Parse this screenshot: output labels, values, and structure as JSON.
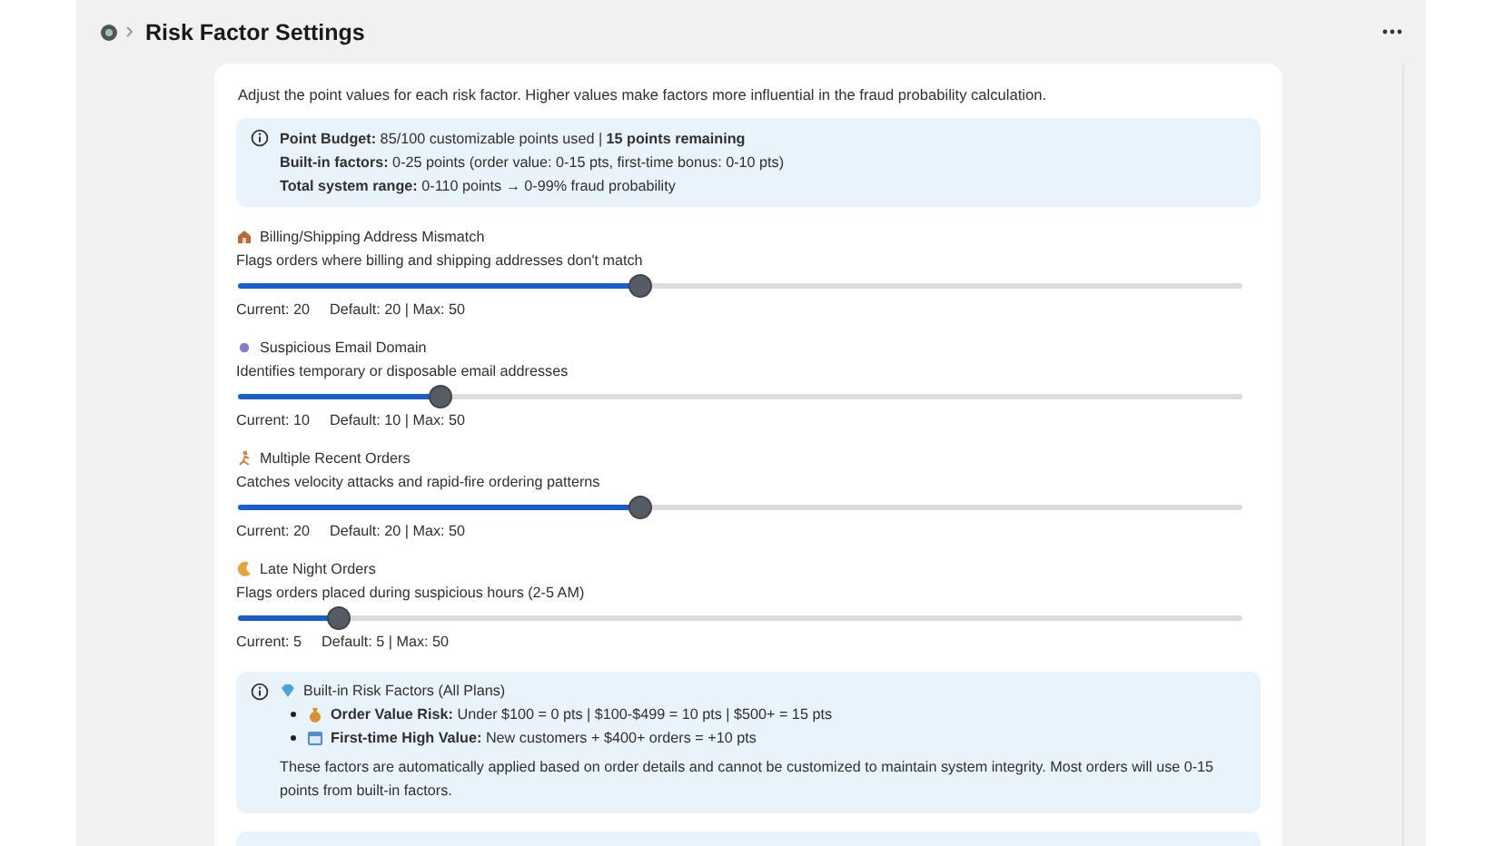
{
  "header": {
    "title": "Risk Factor Settings"
  },
  "intro": "Adjust the point values for each risk factor. Higher values make factors more influential in the fraud probability calculation.",
  "budget_notice": {
    "lines": [
      "**Point Budget:** 85/100 customizable points used | **15 points remaining**",
      "**Built-in factors:** 0-25 points (order value: 0-15 pts, first-time bonus: 0-10 pts)",
      "**Total system range:** 0-110 points → 0-99% fraud probability"
    ]
  },
  "factors": [
    {
      "kind": "house",
      "title": "Billing/Shipping Address Mismatch",
      "description": "Flags orders where billing and shipping addresses don't match",
      "level": 0.4,
      "current": "Current: 20",
      "limits": "Default: 20 | Max: 50"
    },
    {
      "kind": "dot",
      "title": "Suspicious Email Domain",
      "description": "Identifies temporary or disposable email addresses",
      "level": 0.2,
      "current": "Current: 10",
      "limits": "Default: 10 | Max: 50"
    },
    {
      "kind": "runner",
      "title": "Multiple Recent Orders",
      "description": "Catches velocity attacks and rapid-fire ordering patterns",
      "level": 0.4,
      "current": "Current: 20",
      "limits": "Default: 20 | Max: 50"
    },
    {
      "kind": "moon",
      "title": "Late Night Orders",
      "description": "Flags orders placed during suspicious hours (2-5 AM)",
      "level": 0.1,
      "current": "Current: 5",
      "limits": "Default: 5 | Max: 50"
    }
  ],
  "builtin_notice": {
    "title": "Built-in Risk Factors (All Plans)",
    "items": [
      {
        "kind": "bag",
        "text": "**Order Value Risk:** Under $100 = 0 pts | $100-$499 = 10 pts | $500+ = 15 pts"
      },
      {
        "kind": "calendar",
        "text": "**First-time High Value:** New customers + $400+ orders = +10 pts"
      }
    ],
    "note": "These factors are automatically applied based on order details and cannot be customized to maintain system integrity. Most orders will use 0-15 points from built-in factors."
  }
}
